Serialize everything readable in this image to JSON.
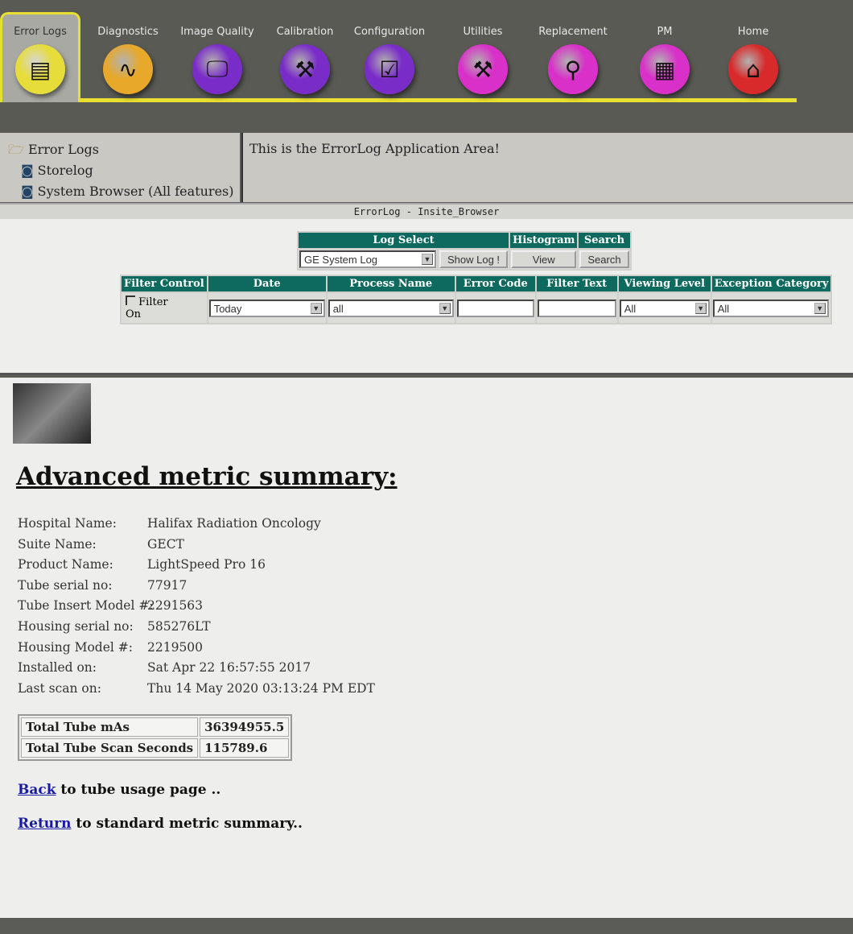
{
  "tabs": [
    {
      "label": "Error Logs",
      "icon": "log-table-icon",
      "color": "#e6dc3a",
      "glyph": "▤"
    },
    {
      "label": "Diagnostics",
      "icon": "stethoscope-icon",
      "color": "#e8a82a",
      "glyph": "∿"
    },
    {
      "label": "Image Quality",
      "icon": "monitor-star-icon",
      "color": "#7a2cc8",
      "glyph": "🖵"
    },
    {
      "label": "Calibration",
      "icon": "caliper-icon",
      "color": "#7a2cc8",
      "glyph": "⚒"
    },
    {
      "label": "Configuration",
      "icon": "checklist-icon",
      "color": "#7a2cc8",
      "glyph": "☑"
    },
    {
      "label": "Utilities",
      "icon": "toolbox-icon",
      "color": "#d830c8",
      "glyph": "⚒"
    },
    {
      "label": "Replacement",
      "icon": "wrench-bolt-icon",
      "color": "#d830c8",
      "glyph": "⚲"
    },
    {
      "label": "PM",
      "icon": "calendar-wrench-icon",
      "color": "#d830c8",
      "glyph": "▦"
    },
    {
      "label": "Home",
      "icon": "home-icon",
      "color": "#d82a2a",
      "glyph": "⌂"
    }
  ],
  "tree": {
    "root": "Error Logs",
    "items": [
      "Storelog",
      "System Browser (All features)"
    ]
  },
  "app_area_text": "This is the ErrorLog Application Area!",
  "window_title": "ErrorLog - Insite_Browser",
  "log_select": {
    "header": "Log Select",
    "value": "GE System Log",
    "show_button": "Show Log !",
    "histogram_header": "Histogram",
    "view_button": "View",
    "search_header": "Search",
    "search_button": "Search"
  },
  "filters": {
    "headers": [
      "Filter Control",
      "Date",
      "Process Name",
      "Error Code",
      "Filter Text",
      "Viewing Level",
      "Exception Category"
    ],
    "filter_on_label": "Filter On",
    "filter_on_checked": false,
    "date": "Today",
    "process": "all",
    "error_code": "",
    "filter_text": "",
    "viewing_level": "All",
    "exception_category": "All"
  },
  "content": {
    "heading": "Advanced metric summary:",
    "fields": [
      {
        "k": "Hospital Name:",
        "v": "Halifax Radiation Oncology"
      },
      {
        "k": "Suite Name:",
        "v": "GECT"
      },
      {
        "k": "Product Name:",
        "v": "LightSpeed Pro 16"
      },
      {
        "k": "Tube serial no:",
        "v": "77917"
      },
      {
        "k": "Tube Insert Model #:",
        "v": "2291563"
      },
      {
        "k": "Housing serial no:",
        "v": "585276LT"
      },
      {
        "k": "Housing Model #:",
        "v": "2219500"
      },
      {
        "k": "Installed on:",
        "v": "Sat Apr 22 16:57:55 2017"
      },
      {
        "k": "Last scan on:",
        "v": "Thu 14 May 2020 03:13:24 PM EDT"
      }
    ],
    "usage": [
      {
        "k": "Total Tube mAs",
        "v": "36394955.5"
      },
      {
        "k": "Total Tube Scan Seconds",
        "v": "115789.6"
      }
    ],
    "back_link": "Back",
    "back_text": " to tube usage page ..",
    "return_link": "Return",
    "return_text": " to standard metric summary.."
  }
}
